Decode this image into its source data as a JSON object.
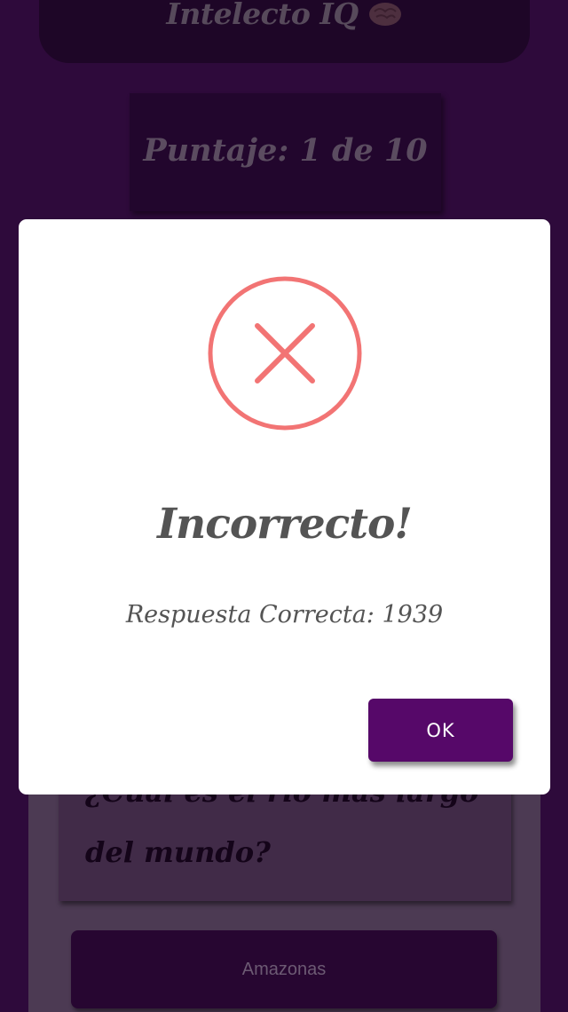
{
  "app": {
    "title": "Intelecto IQ",
    "title_icon": "brain-icon"
  },
  "score": {
    "text": "Puntaje: 1 de 10"
  },
  "question": {
    "text": "¿Cuál es el río más largo del mundo?"
  },
  "answers": [
    {
      "label": "Amazonas"
    }
  ],
  "modal": {
    "icon": "error-x-icon",
    "title": "Incorrecto!",
    "message": "Respuesta Correcta: 1939",
    "ok_label": "OK"
  },
  "colors": {
    "background": "#2e0a3b",
    "accent": "#560869",
    "error": "#f27474",
    "modal_text": "#545454"
  }
}
